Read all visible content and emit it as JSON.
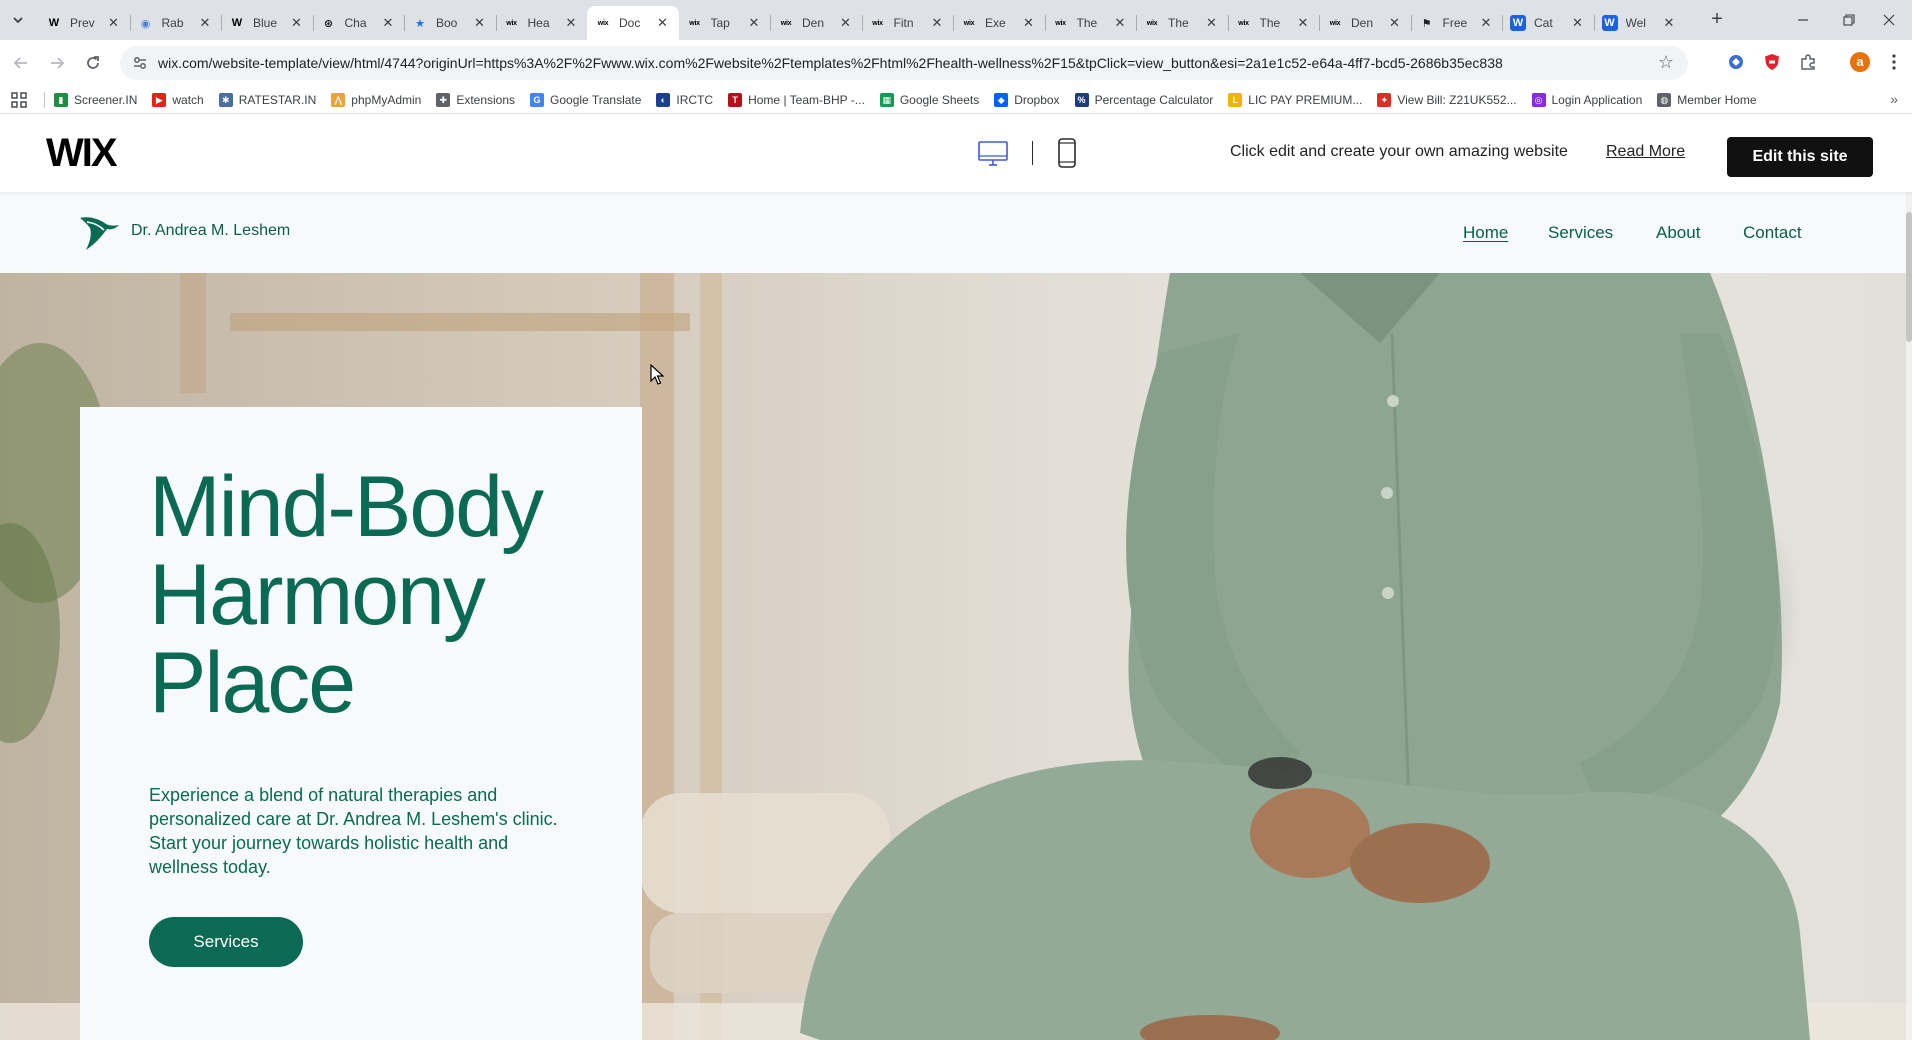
{
  "browser": {
    "tabs": [
      {
        "title": "Prev",
        "favicon": "wikipedia-icon",
        "fav_text": "W",
        "fav_color": "#000000",
        "fav_bg": "transparent"
      },
      {
        "title": "Rab",
        "favicon": "globe-icon",
        "fav_text": "◉",
        "fav_color": "#4a7fd6",
        "fav_bg": "transparent"
      },
      {
        "title": "Blue",
        "favicon": "wikipedia-icon",
        "fav_text": "W",
        "fav_color": "#000000",
        "fav_bg": "transparent"
      },
      {
        "title": "Cha",
        "favicon": "chatgpt-icon",
        "fav_text": "⊛",
        "fav_color": "#202124",
        "fav_bg": "transparent"
      },
      {
        "title": "Boo",
        "favicon": "bookmark-star-icon",
        "fav_text": "★",
        "fav_color": "#1a73e8",
        "fav_bg": "transparent"
      },
      {
        "title": "Hea",
        "favicon": "wix-icon",
        "fav_text": "wix",
        "fav_color": "#000000",
        "fav_bg": "transparent"
      },
      {
        "title": "Doc",
        "favicon": "wix-icon",
        "fav_text": "wix",
        "fav_color": "#000000",
        "fav_bg": "transparent",
        "active": true
      },
      {
        "title": "Tap",
        "favicon": "wix-icon",
        "fav_text": "wix",
        "fav_color": "#000000",
        "fav_bg": "transparent"
      },
      {
        "title": "Den",
        "favicon": "wix-icon",
        "fav_text": "wix",
        "fav_color": "#000000",
        "fav_bg": "transparent"
      },
      {
        "title": "Fitn",
        "favicon": "wix-icon",
        "fav_text": "wix",
        "fav_color": "#000000",
        "fav_bg": "transparent"
      },
      {
        "title": "Exe",
        "favicon": "wix-icon",
        "fav_text": "wix",
        "fav_color": "#000000",
        "fav_bg": "transparent"
      },
      {
        "title": "The",
        "favicon": "wix-icon",
        "fav_text": "wix",
        "fav_color": "#000000",
        "fav_bg": "transparent"
      },
      {
        "title": "The",
        "favicon": "wix-icon",
        "fav_text": "wix",
        "fav_color": "#000000",
        "fav_bg": "transparent"
      },
      {
        "title": "The",
        "favicon": "wix-icon",
        "fav_text": "wix",
        "fav_color": "#000000",
        "fav_bg": "transparent"
      },
      {
        "title": "Den",
        "favicon": "wix-icon",
        "fav_text": "wix",
        "fav_color": "#000000",
        "fav_bg": "transparent"
      },
      {
        "title": "Free",
        "favicon": "flag-icon",
        "fav_text": "⚑",
        "fav_color": "#202124",
        "fav_bg": "transparent"
      },
      {
        "title": "Cat",
        "favicon": "wix-w-icon",
        "fav_text": "W",
        "fav_color": "#ffffff",
        "fav_bg": "#1a62e0"
      },
      {
        "title": "Wel",
        "favicon": "wix-w-icon",
        "fav_text": "W",
        "fav_color": "#ffffff",
        "fav_bg": "#1a62e0"
      }
    ],
    "url": "wix.com/website-template/view/html/4744?originUrl=https%3A%2F%2Fwww.wix.com%2Fwebsite%2Ftemplates%2Fhtml%2Fhealth-wellness%2F15&tpClick=view_button&esi=2a1e1c52-e64a-4ff7-bcd5-2686b35ec838",
    "profile_initial": "a",
    "bookmarks": [
      {
        "label": "Screener.IN",
        "icon": "bar-chart-icon",
        "icon_text": "▮",
        "icon_color": "#1e8e3e"
      },
      {
        "label": "watch",
        "icon": "youtube-icon",
        "icon_text": "▶",
        "icon_color": "#e62117"
      },
      {
        "label": "RATESTAR.IN",
        "icon": "spark-icon",
        "icon_text": "✱",
        "icon_color": "#4a6fa5"
      },
      {
        "label": "phpMyAdmin",
        "icon": "phpmyadmin-icon",
        "icon_text": "⋀",
        "icon_color": "#e8a33d"
      },
      {
        "label": "Extensions",
        "icon": "puzzle-icon",
        "icon_text": "✚",
        "icon_color": "#5f6368"
      },
      {
        "label": "Google Translate",
        "icon": "translate-icon",
        "icon_text": "G",
        "icon_color": "#4285f4"
      },
      {
        "label": "IRCTC",
        "icon": "irctc-icon",
        "icon_text": "◐",
        "icon_color": "#1d3f8f"
      },
      {
        "label": "Home | Team-BHP -...",
        "icon": "team-bhp-icon",
        "icon_text": "T",
        "icon_color": "#b3121d"
      },
      {
        "label": "Google Sheets",
        "icon": "sheets-icon",
        "icon_text": "▦",
        "icon_color": "#0f9d58"
      },
      {
        "label": "Dropbox",
        "icon": "dropbox-icon",
        "icon_text": "◆",
        "icon_color": "#0061fe"
      },
      {
        "label": "Percentage Calculator",
        "icon": "percent-icon",
        "icon_text": "%",
        "icon_color": "#1f3c7a"
      },
      {
        "label": "LIC PAY PREMIUM...",
        "icon": "lic-icon",
        "icon_text": "L",
        "icon_color": "#f2b400"
      },
      {
        "label": "View Bill: Z21UK552...",
        "icon": "bill-icon",
        "icon_text": "✦",
        "icon_color": "#d93025"
      },
      {
        "label": "Login Application",
        "icon": "login-icon",
        "icon_text": "◎",
        "icon_color": "#8a2be2"
      },
      {
        "label": "Member Home",
        "icon": "globe-icon",
        "icon_text": "◍",
        "icon_color": "#5f6368"
      }
    ]
  },
  "wix_bar": {
    "logo": "WIX",
    "tagline": "Click edit and create your own amazing website",
    "read_more": "Read More",
    "edit_button": "Edit this site"
  },
  "site": {
    "name": "Dr. Andrea M. Leshem",
    "nav": [
      {
        "label": "Home",
        "active": true
      },
      {
        "label": "Services"
      },
      {
        "label": "About"
      },
      {
        "label": "Contact"
      }
    ],
    "hero": {
      "title_lines": [
        "Mind-Body",
        "Harmony",
        "Place"
      ],
      "description": "Experience a blend of natural therapies and personalized care at Dr. Andrea M. Leshem's clinic. Start your journey towards holistic health and wellness today.",
      "button": "Services"
    }
  },
  "colors": {
    "brand_green": "#0b6a53",
    "wix_button": "#111111"
  }
}
